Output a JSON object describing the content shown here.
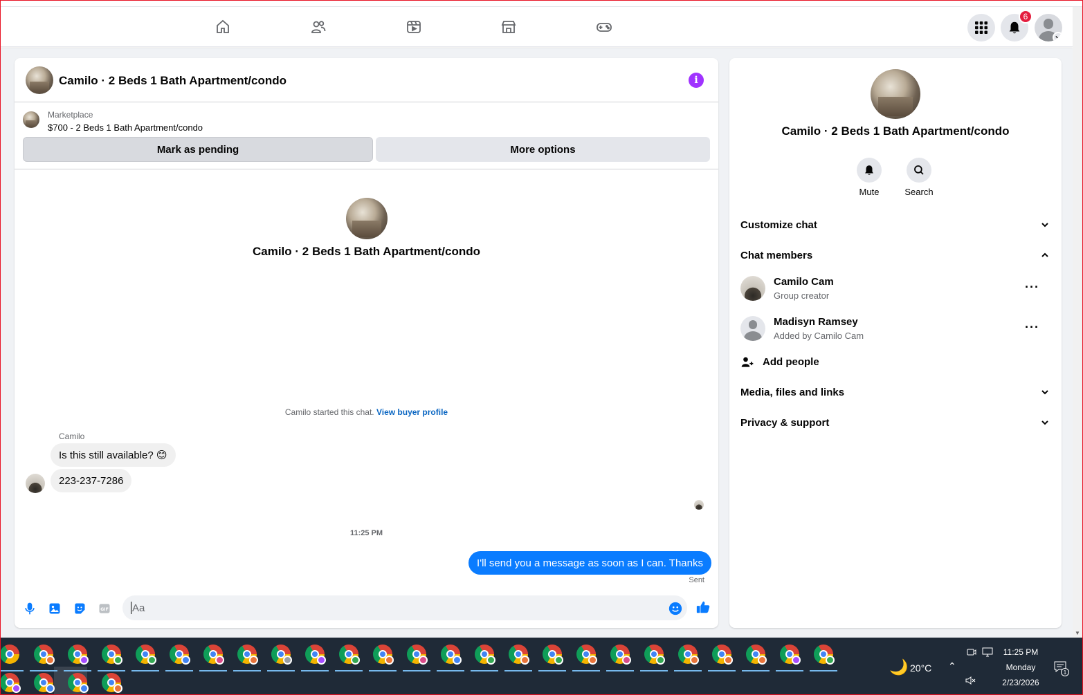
{
  "topnav": {
    "icons": [
      "home-icon",
      "friends-icon",
      "video-icon",
      "marketplace-icon",
      "gaming-icon"
    ],
    "menu_icon": "menu-grid-icon",
    "notifications_icon": "bell-icon",
    "notifications_count": "6",
    "account_icon": "account-icon"
  },
  "chat": {
    "title": "Camilo · 2 Beds 1 Bath Apartment/condo",
    "info_icon": "i",
    "listing": {
      "kind": "Marketplace",
      "title": "$700 - 2 Beds 1 Bath Apartment/condo"
    },
    "mark_pending": "Mark as pending",
    "more_options": "More options",
    "intro_name": "Camilo · 2 Beds 1 Bath Apartment/condo",
    "started_text": "Camilo started this chat.",
    "view_buyer_profile": "View buyer profile",
    "sender_name": "Camilo",
    "messages_in": [
      "Is this still available? 😊",
      "223-237-7286"
    ],
    "time": "11:25 PM",
    "message_out": "I'll send you a message as soon as I can. Thanks",
    "sent_label": "Sent",
    "input_placeholder": "Aa",
    "composer_icons": [
      "microphone-icon",
      "photo-icon",
      "sticker-icon",
      "gif-icon",
      "emoji-icon",
      "thumbs-up-icon"
    ]
  },
  "panel": {
    "name": "Camilo · 2 Beds 1 Bath Apartment/condo",
    "mute_label": "Mute",
    "search_label": "Search",
    "customize_chat": "Customize chat",
    "chat_members": "Chat members",
    "members": [
      {
        "name": "Camilo Cam",
        "sub": "Group creator"
      },
      {
        "name": "Madisyn Ramsey",
        "sub": "Added by Camilo Cam"
      }
    ],
    "add_people": "Add people",
    "media_files_links": "Media, files and links",
    "privacy_support": "Privacy & support"
  },
  "taskbar": {
    "weather_temp": "20°C",
    "time": "11:25 PM",
    "day": "Monday",
    "date": "2/23/2026",
    "notification_count": "1",
    "profile_colors": [
      "#e8743b",
      "#a64dff",
      "#34a853",
      "#34a853",
      "#4285f4",
      "#d94c8a",
      "#e8743b",
      "#9aa0a6",
      "#a64dff",
      "#34a853",
      "#e8743b",
      "#d94c8a",
      "#4285f4",
      "#34a853",
      "#e8743b",
      "#34a853",
      "#e8743b",
      "#d94c8a",
      "#34a853",
      "#e8743b",
      "#e8743b"
    ]
  }
}
